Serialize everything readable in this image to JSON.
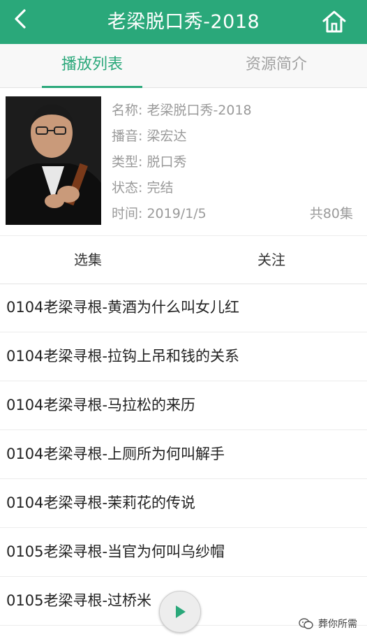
{
  "header": {
    "title": "老梁脱口秀-2018",
    "back_icon": "chevron-left-icon",
    "home_icon": "home-icon",
    "background": "#2aa87a"
  },
  "tabs": [
    {
      "label": "播放列表",
      "active": true
    },
    {
      "label": "资源简介",
      "active": false
    }
  ],
  "info": {
    "name": "名称: 老梁脱口秀-2018",
    "host": "播音: 梁宏达",
    "type": "类型: 脱口秀",
    "status": "状态: 完结",
    "time": "时间: 2019/1/5",
    "total": "共80集"
  },
  "actions": {
    "select_episodes": "选集",
    "follow": "关注"
  },
  "episodes": [
    "0104老梁寻根-黄酒为什么叫女儿红",
    "0104老梁寻根-拉钩上吊和钱的关系",
    "0104老梁寻根-马拉松的来历",
    "0104老梁寻根-上厕所为何叫解手",
    "0104老梁寻根-茉莉花的传说",
    "0105老梁寻根-当官为何叫乌纱帽",
    "0105老梁寻根-过桥米"
  ],
  "player": {
    "icon": "play-icon",
    "accent": "#2aa87a"
  },
  "watermark": {
    "text": "葬你所需",
    "icon": "wechat-icon"
  }
}
